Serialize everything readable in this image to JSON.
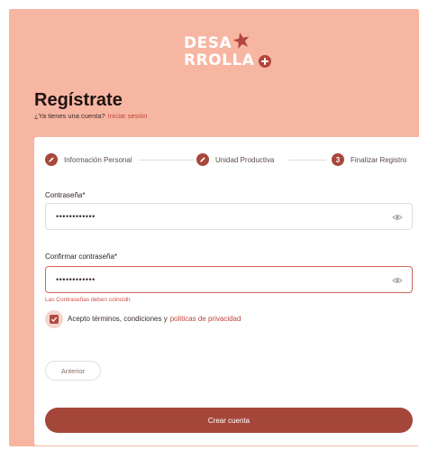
{
  "brand": {
    "logo_line1": "DESA",
    "logo_line2": "RROLLA",
    "colors": {
      "background": "#f7b6a2",
      "accent": "#a5463b",
      "link": "#c0453a",
      "error": "#d0504a"
    }
  },
  "header": {
    "title": "Regístrate",
    "subtitle": "¿Ya tienes una cuenta?",
    "login_link": "Iniciar sesión"
  },
  "steps": [
    {
      "label": "Información Personal",
      "icon": "pencil-icon",
      "marker": ""
    },
    {
      "label": "Unidad Productiva",
      "icon": "pencil-icon",
      "marker": ""
    },
    {
      "label": "Finalizar Registro",
      "icon": "",
      "marker": "3"
    }
  ],
  "form": {
    "password": {
      "label": "Contraseña*",
      "value": "••••••••••••",
      "icon": "eye-icon"
    },
    "confirm_password": {
      "label": "Confirmar contraseña*",
      "value": "••••••••••••",
      "icon": "eye-icon"
    },
    "error_message": "Las Contraseñas deben coincidir.",
    "terms": {
      "checked": true,
      "text": "Acepto términos, condiciones y",
      "link": "politicas de privacidad"
    }
  },
  "buttons": {
    "back_label": "Anterior",
    "create_label": "Crear cuenta"
  }
}
